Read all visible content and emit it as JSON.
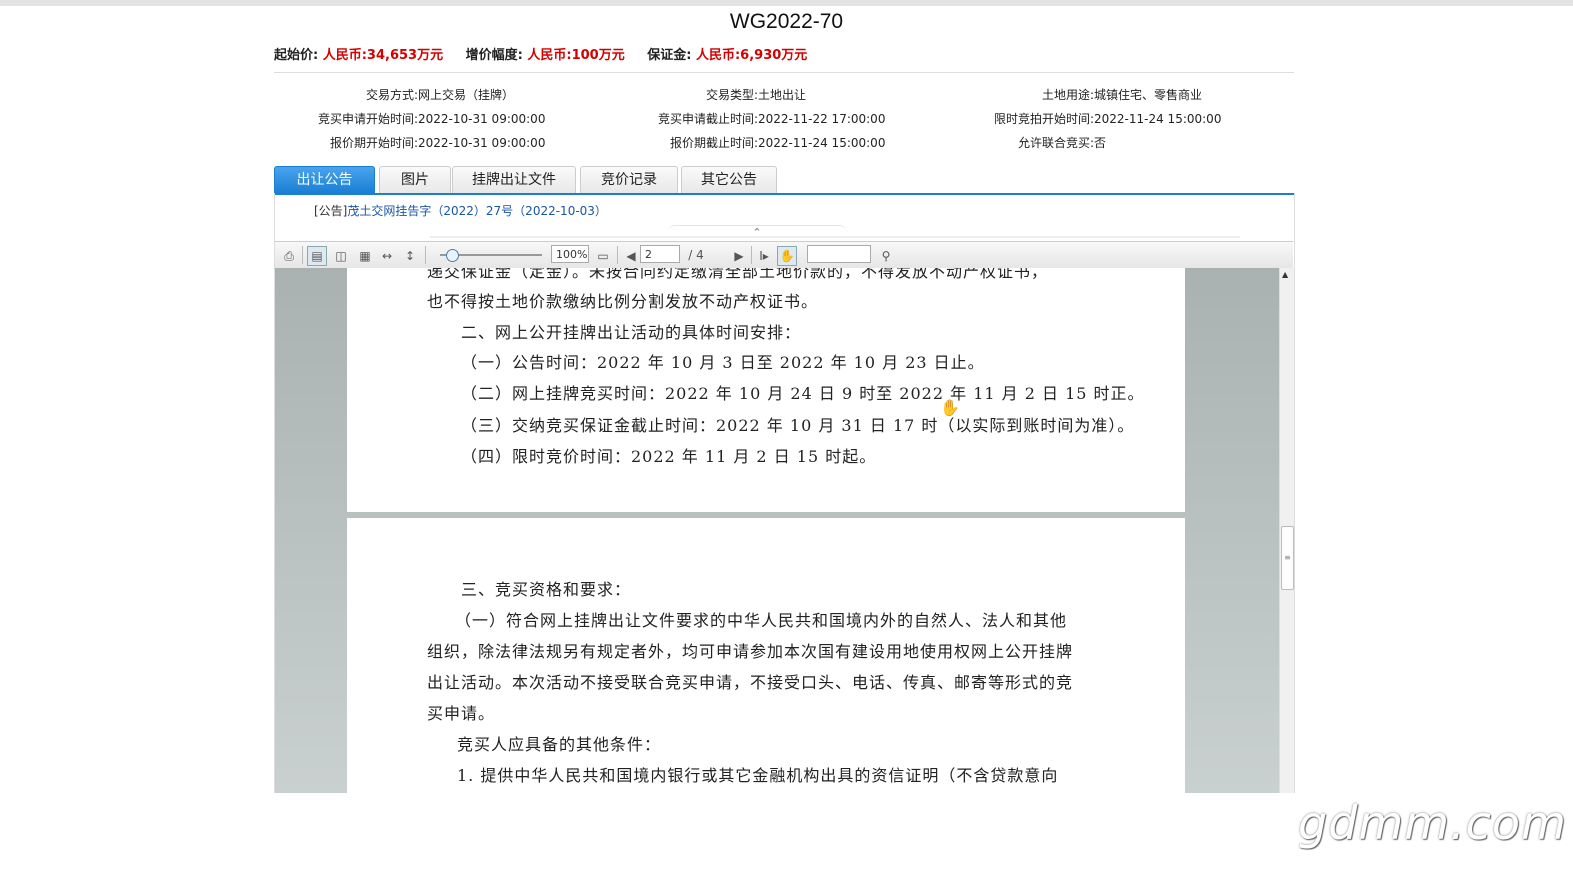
{
  "title": "WG2022-70",
  "prices": {
    "start_label": "起始价:",
    "start_value": "人民币:34,653万元",
    "increment_label": "增价幅度:",
    "increment_value": "人民币:100万元",
    "deposit_label": "保证金:",
    "deposit_value": "人民币:6,930万元"
  },
  "info": {
    "col1": [
      {
        "k": "交易方式:",
        "v": "网上交易（挂牌）"
      },
      {
        "k": "竞买申请开始时间:",
        "v": "2022-10-31 09:00:00"
      },
      {
        "k": "报价期开始时间:",
        "v": "2022-10-31 09:00:00"
      }
    ],
    "col2": [
      {
        "k": "交易类型:",
        "v": "土地出让"
      },
      {
        "k": "竞买申请截止时间:",
        "v": "2022-11-22 17:00:00"
      },
      {
        "k": "报价期截止时间:",
        "v": "2022-11-24 15:00:00"
      }
    ],
    "col3": [
      {
        "k": "土地用途:",
        "v": "城镇住宅、零售商业"
      },
      {
        "k": "限时竞拍开始时间:",
        "v": "2022-11-24 15:00:00"
      },
      {
        "k": "允许联合竞买:",
        "v": "否"
      }
    ]
  },
  "tabs": [
    "出让公告",
    "图片",
    "挂牌出让文件",
    "竞价记录",
    "其它公告"
  ],
  "notice": {
    "prefix": "[公告]",
    "link": "茂土交网挂告字（2022）27号（2022-10-03）"
  },
  "toolbar": {
    "zoom": "100%",
    "page_current": "2",
    "page_total": "/ 4",
    "search_placeholder": "",
    "icons": [
      "print-icon",
      "single-page-icon",
      "two-page-icon",
      "thumbnails-icon",
      "fit-width-icon",
      "fit-height-icon",
      "fullscreen-icon",
      "prev-page-icon",
      "next-page-icon",
      "text-select-icon",
      "hand-tool-icon",
      "search-icon"
    ]
  },
  "document": {
    "page1_lines": [
      "递交保证金（定金）。未按合同约定缴清全部土地价款的，不得发放不动产权证书，",
      "也不得按土地价款缴纳比例分割发放不动产权证书。",
      "二、网上公开挂牌出让活动的具体时间安排：",
      "（一）公告时间：2022 年 10 月 3 日至 2022 年 10 月 23 日止。",
      "（二）网上挂牌竞买时间：2022 年 10 月 24 日 9 时至 2022 年 11 月 2 日 15 时正。",
      "（三）交纳竞买保证金截止时间：2022 年 10 月 31 日 17 时（以实际到账时间为准）。",
      "（四）限时竞价时间：2022 年 11 月 2 日 15 时起。"
    ],
    "page2_lines": [
      "三、竞买资格和要求：",
      "（一）符合网上挂牌出让文件要求的中华人民共和国境内外的自然人、法人和其他",
      "组织，除法律法规另有规定者外，均可申请参加本次国有建设用地使用权网上公开挂牌",
      "出让活动。本次活动不接受联合竞买申请，不接受口头、电话、传真、邮寄等形式的竞",
      "买申请。",
      "竞买人应具备的其他条件：",
      "1. 提供中华人民共和国境内银行或其它金融机构出具的资信证明（不含贷款意向"
    ]
  },
  "watermark": "gdmm.com"
}
